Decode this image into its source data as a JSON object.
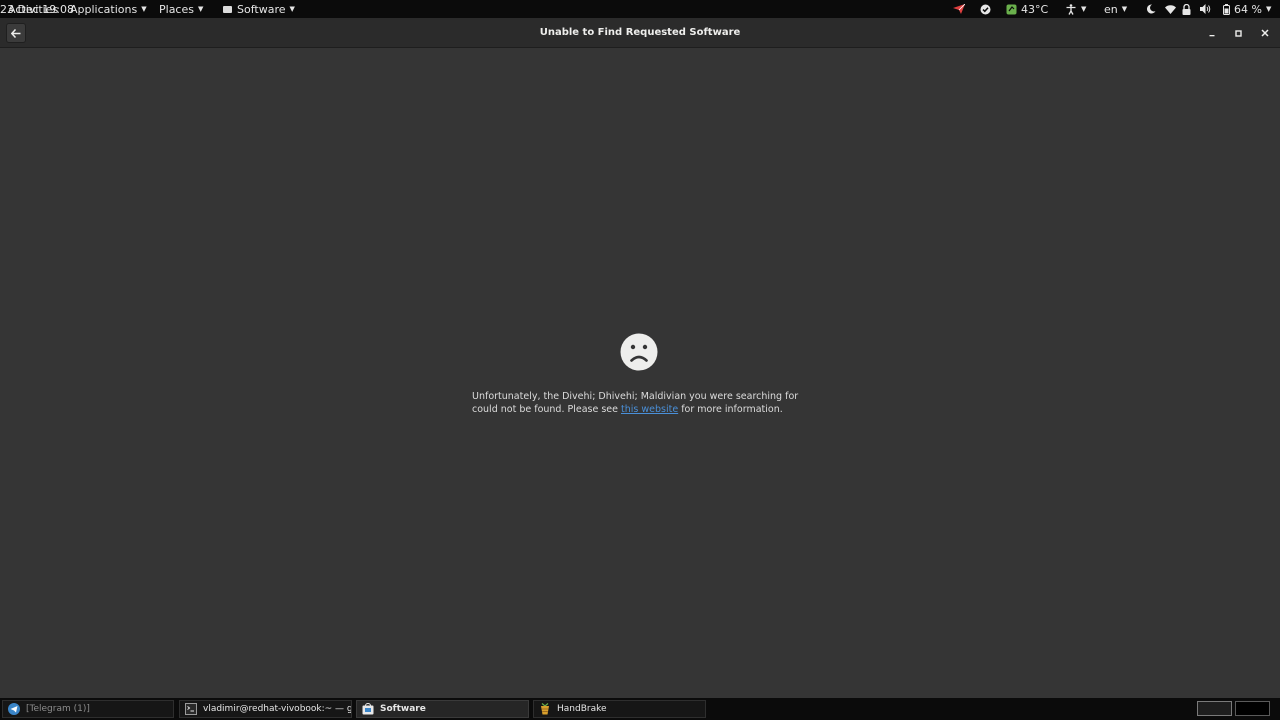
{
  "top_panel": {
    "activities": "Activities",
    "applications": "Applications",
    "places": "Places",
    "app_menu": "Software",
    "clock": "23 Dec  19:08",
    "temperature": "43°C",
    "language": "en",
    "battery": "64 %"
  },
  "window": {
    "title": "Unable to Find Requested Software"
  },
  "content": {
    "message_pre": "Unfortunately, the Divehi; Dhivehi; Maldivian you were searching for could not be found. Please see ",
    "link_text": "this website",
    "message_post": " for more information."
  },
  "taskbar": {
    "tasks": [
      {
        "label": "[Telegram (1)]"
      },
      {
        "label": "vladimir@redhat-vivobook:~ — ghb"
      },
      {
        "label": "Software"
      },
      {
        "label": "HandBrake"
      }
    ]
  },
  "colors": {
    "panel_bg": "#0b0b0b",
    "window_bg": "#353535",
    "headerbar_bg": "#2b2b2b",
    "link": "#4a90d9",
    "accent_red": "#e04040",
    "accent_green": "#6ab04c"
  },
  "icons": {
    "back": "arrow-left-icon",
    "sad": "sad-face-icon",
    "minimize": "minimize-icon",
    "maximize": "maximize-icon",
    "close": "close-icon"
  }
}
